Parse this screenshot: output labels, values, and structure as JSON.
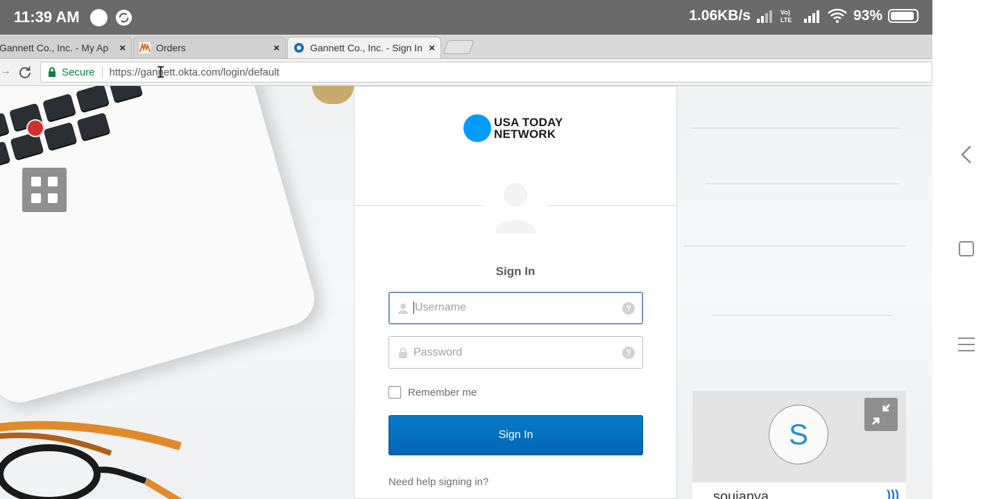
{
  "status_bar": {
    "time": "11:39 AM",
    "network_speed": "1.06KB/s",
    "volte_label": "Vo) LTE",
    "battery_percent": "93%",
    "battery_level": 0.93
  },
  "browser": {
    "tabs": [
      {
        "title": "Gannett Co., Inc. - My Ap",
        "close": "×",
        "icon": "none"
      },
      {
        "title": "Orders",
        "close": "×",
        "icon": "orders-favicon"
      },
      {
        "title": "Gannett Co., Inc. - Sign In",
        "close": "×",
        "icon": "okta-favicon",
        "active": true
      }
    ],
    "secure_label": "Secure",
    "url": "https://gannett.okta.com/login/default"
  },
  "login": {
    "brand_line1": "USA TODAY",
    "brand_line2": "NETWORK",
    "title": "Sign In",
    "username_placeholder": "Username",
    "password_placeholder": "Password",
    "remember_label": "Remember me",
    "submit_label": "Sign In",
    "help_link": "Need help signing in?",
    "help_glyph": "?"
  },
  "widget": {
    "initial": "S",
    "name": "soujanya"
  },
  "colors": {
    "status_bar": "#6a6a6a",
    "accent_blue": "#0066b3",
    "brand_dot": "#009bff",
    "secure_green": "#0b8043"
  }
}
